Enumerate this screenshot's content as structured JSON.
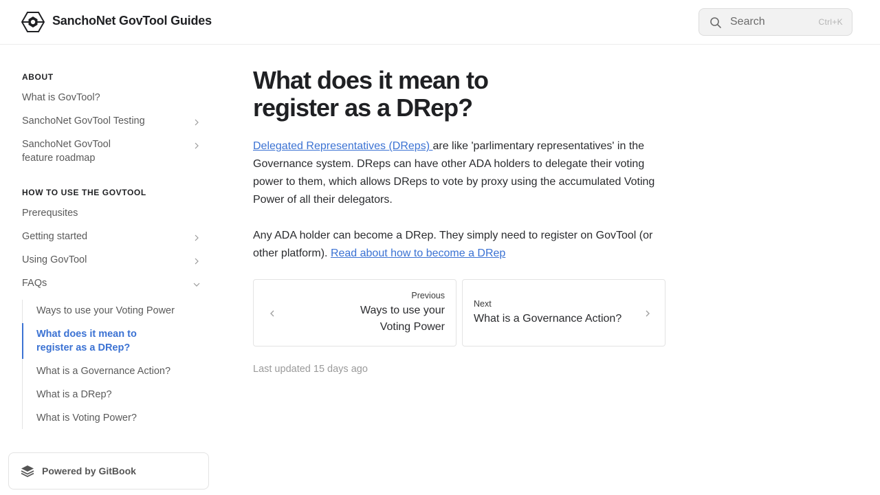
{
  "header": {
    "site_title": "SanchoNet GovTool Guides",
    "search_placeholder": "Search",
    "search_shortcut": "Ctrl+K",
    "logo_icon": "hexagon-logo-icon",
    "search_icon": "search-icon"
  },
  "sidebar": {
    "sections": [
      {
        "title": "ABOUT",
        "items": [
          {
            "label": "What is GovTool?",
            "expandable": false
          },
          {
            "label": "SanchoNet GovTool Testing",
            "expandable": true
          },
          {
            "label": "SanchoNet GovTool feature roadmap",
            "expandable": true
          }
        ]
      },
      {
        "title": "HOW TO USE THE GOVTOOL",
        "items": [
          {
            "label": "Prerequsites",
            "expandable": false
          },
          {
            "label": "Getting started",
            "expandable": true
          },
          {
            "label": "Using GovTool",
            "expandable": true
          },
          {
            "label": "FAQs",
            "expandable": true,
            "expanded": true
          }
        ]
      }
    ],
    "faq_items": [
      {
        "label": "Ways to use your Voting Power",
        "active": false
      },
      {
        "label": "What does it mean to register as a DRep?",
        "active": true
      },
      {
        "label": "What is a Governance Action?",
        "active": false
      },
      {
        "label": "What is a DRep?",
        "active": false
      },
      {
        "label": "What is Voting Power?",
        "active": false
      }
    ],
    "powered_by": "Powered by GitBook"
  },
  "main": {
    "title": "What does it mean to register as a DRep?",
    "para1": {
      "link": "Delegated Representatives (DReps) ",
      "text": "are like 'parlimentary representatives' in the Governance system. DReps can have other ADA holders to delegate their voting power to them, which allows DReps to vote by proxy using the accumulated Voting Power of all their delegators."
    },
    "para2": {
      "text": "Any ADA holder can become a DRep. They simply need to register on GovTool (or other platform). ",
      "link": "Read about how to become a DRep"
    },
    "prev": {
      "label": "Previous",
      "title": "Ways to use your Voting Power"
    },
    "next": {
      "label": "Next",
      "title": "What is a Governance Action?"
    },
    "last_updated": "Last updated 15 days ago"
  },
  "colors": {
    "accent": "#3b72d3",
    "text": "#1f2023",
    "muted": "#5a5a5a",
    "border": "#e3e3e3"
  }
}
